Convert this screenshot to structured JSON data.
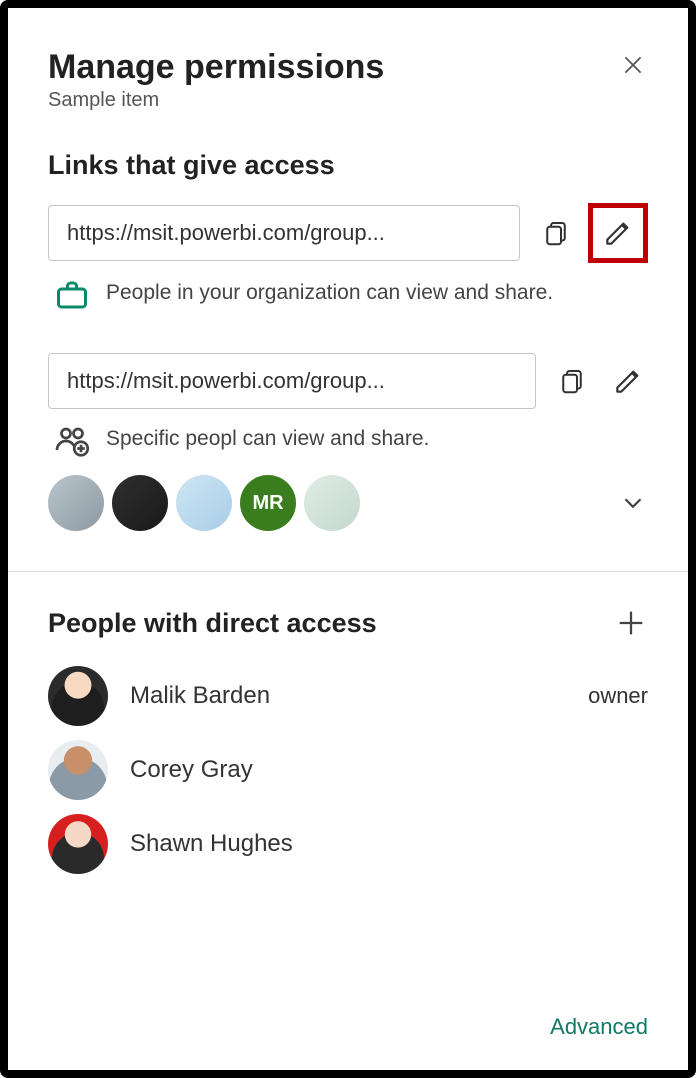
{
  "header": {
    "title": "Manage permissions",
    "subtitle": "Sample item"
  },
  "links_section": {
    "heading": "Links that give access",
    "links": [
      {
        "url": "https://msit.powerbi.com/group...",
        "description": "People in your organization can view and share.",
        "icon": "briefcase"
      },
      {
        "url": "https://msit.powerbi.com/group...",
        "description": "Specific peopl can view and share.",
        "icon": "people-add",
        "avatar_initials": "MR"
      }
    ]
  },
  "direct_section": {
    "heading": "People with direct access",
    "people": [
      {
        "name": "Malik Barden",
        "role": "owner"
      },
      {
        "name": "Corey Gray",
        "role": ""
      },
      {
        "name": "Shawn Hughes",
        "role": ""
      }
    ]
  },
  "footer": {
    "advanced": "Advanced"
  }
}
